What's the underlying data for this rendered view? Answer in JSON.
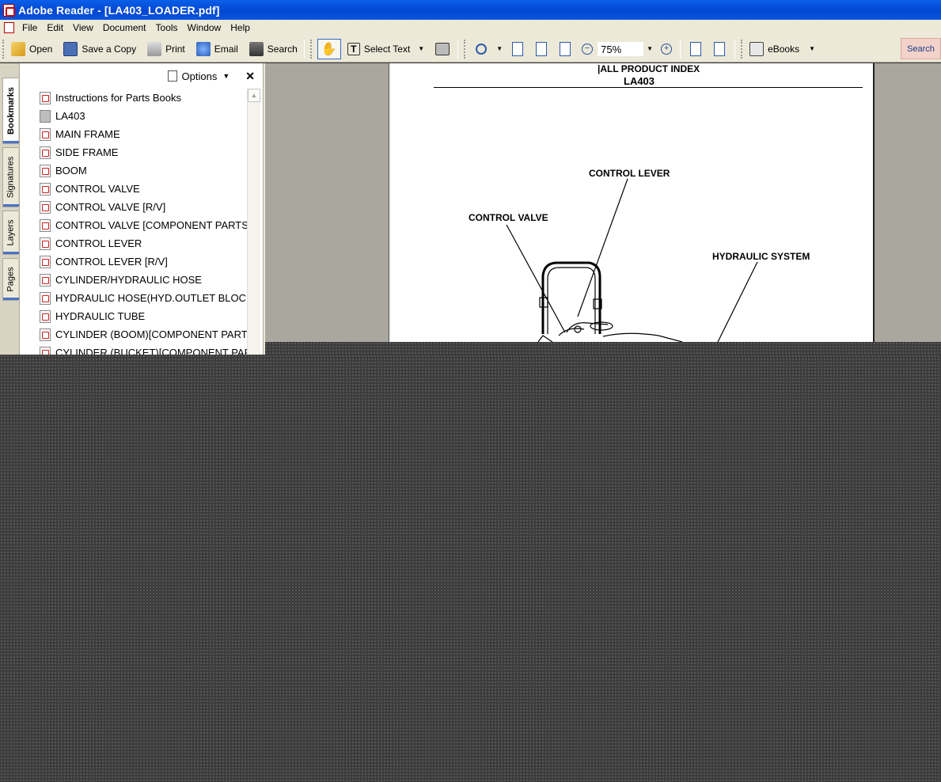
{
  "window": {
    "title": "Adobe Reader - [LA403_LOADER.pdf]"
  },
  "menu": [
    "File",
    "Edit",
    "View",
    "Document",
    "Tools",
    "Window",
    "Help"
  ],
  "toolbar": {
    "open": "Open",
    "save_copy": "Save a Copy",
    "print": "Print",
    "email": "Email",
    "search": "Search",
    "select_text": "Select Text",
    "zoom": "75%",
    "ebooks": "eBooks",
    "search_right": "Search"
  },
  "side_tabs": [
    "Bookmarks",
    "Signatures",
    "Layers",
    "Pages"
  ],
  "panel": {
    "options": "Options",
    "close": "✕",
    "bookmarks": [
      {
        "label": "Instructions for Parts Books",
        "icon": "pdf-page-icon"
      },
      {
        "label": "LA403",
        "icon": "gray-page-icon"
      },
      {
        "label": "MAIN FRAME",
        "icon": "pdf-page-icon"
      },
      {
        "label": "SIDE FRAME",
        "icon": "pdf-page-icon"
      },
      {
        "label": "BOOM",
        "icon": "pdf-page-icon"
      },
      {
        "label": "CONTROL VALVE",
        "icon": "pdf-page-icon"
      },
      {
        "label": "CONTROL VALVE [R/V]",
        "icon": "pdf-page-icon"
      },
      {
        "label": "CONTROL VALVE [COMPONENT PARTS",
        "icon": "pdf-page-icon"
      },
      {
        "label": "CONTROL LEVER",
        "icon": "pdf-page-icon"
      },
      {
        "label": "CONTROL LEVER [R/V]",
        "icon": "pdf-page-icon"
      },
      {
        "label": "CYLINDER/HYDRAULIC HOSE",
        "icon": "pdf-page-icon"
      },
      {
        "label": "HYDRAULIC HOSE(HYD.OUTLET BLOCK",
        "icon": "pdf-page-icon"
      },
      {
        "label": "HYDRAULIC TUBE",
        "icon": "pdf-page-icon"
      },
      {
        "label": "CYLINDER (BOOM)[COMPONENT PART",
        "icon": "pdf-page-icon"
      },
      {
        "label": "CYLINDER (BUCKET)[COMPONENT PAR",
        "icon": "pdf-page-icon"
      }
    ]
  },
  "document": {
    "header": "|ALL PRODUCT INDEX",
    "model": "LA403",
    "labels": {
      "control_lever": "CONTROL LEVER",
      "control_valve": "CONTROL VALVE",
      "hydraulic_system": "HYDRAULIC SYSTEM"
    }
  }
}
